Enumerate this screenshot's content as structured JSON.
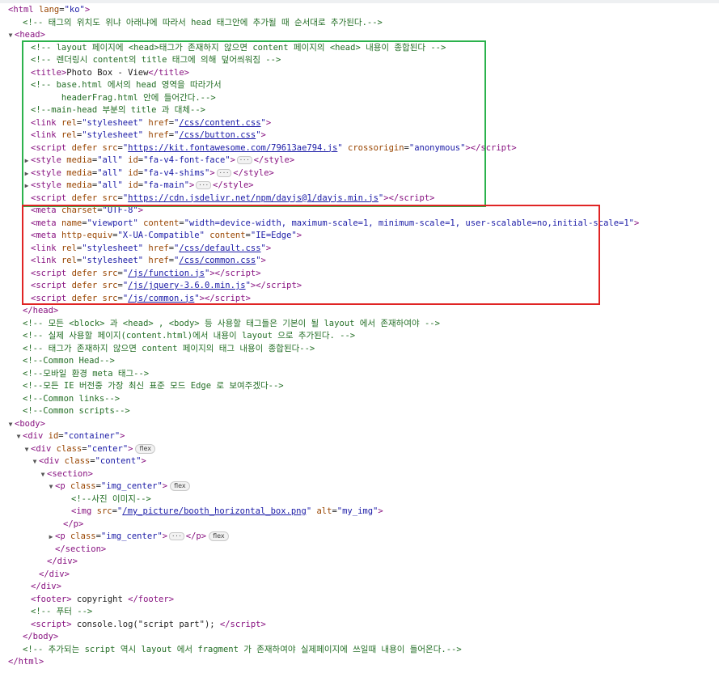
{
  "lines": [
    {
      "indent": 0,
      "toggle": "",
      "html": "<span class='tag'>&lt;html</span> <span class='attr'>lang</span>=<span class='val'>\"ko\"</span><span class='tag'>&gt;</span>"
    },
    {
      "indent": 2,
      "toggle": "",
      "html": "<span class='comment'>&lt;!-- 태그의 위치도 위냐 아래냐에 따라서 head 태그안에 추가될 때 순서대로 추가된다.--&gt;</span>"
    },
    {
      "indent": 1,
      "toggle": "open",
      "html": "<span class='tag'>&lt;head&gt;</span>"
    },
    {
      "indent": 3,
      "toggle": "",
      "html": "<span class='comment'>&lt;!-- layout 페이지에 &lt;head&gt;태그가 존재하지 않으면 content 페이지의 &lt;head&gt; 내용이 종합된다 --&gt;</span>"
    },
    {
      "indent": 3,
      "toggle": "",
      "html": "<span class='comment'>&lt;!-- 렌더링시 content의 title 태그에 의해 덮어씌워짐 --&gt;</span>"
    },
    {
      "indent": 3,
      "toggle": "",
      "html": "<span class='tag'>&lt;title&gt;</span><span class='txt'>Photo Box - View</span><span class='tag'>&lt;/title&gt;</span>"
    },
    {
      "indent": 3,
      "toggle": "",
      "html": "<span class='comment'>&lt;!-- base.html 에서의 head 영역을 따라가서</span>"
    },
    {
      "indent": 3,
      "toggle": "",
      "html": "<span class='comment'>      headerFrag.html 안에 들어간다.--&gt;</span>"
    },
    {
      "indent": 3,
      "toggle": "",
      "html": "<span class='comment'>&lt;!--main-head 부분의 title 과 대체--&gt;</span>"
    },
    {
      "indent": 3,
      "toggle": "",
      "html": "<span class='tag'>&lt;link</span> <span class='attr'>rel</span>=<span class='val'>\"stylesheet\"</span> <span class='attr'>href</span>=<span class='val'>\"</span><span class='link'>/css/content.css</span><span class='val'>\"</span><span class='tag'>&gt;</span>"
    },
    {
      "indent": 3,
      "toggle": "",
      "html": "<span class='tag'>&lt;link</span> <span class='attr'>rel</span>=<span class='val'>\"stylesheet\"</span> <span class='attr'>href</span>=<span class='val'>\"</span><span class='link'>/css/button.css</span><span class='val'>\"</span><span class='tag'>&gt;</span>"
    },
    {
      "indent": 3,
      "toggle": "",
      "html": "<span class='tag'>&lt;script</span> <span class='attr'>defer</span> <span class='attr'>src</span>=<span class='val'>\"</span><span class='link'>https://kit.fontawesome.com/79613ae794.js</span><span class='val'>\"</span> <span class='attr'>crossorigin</span>=<span class='val'>\"anonymous\"</span><span class='tag'>&gt;&lt;/script&gt;</span>"
    },
    {
      "indent": 3,
      "toggle": "closed",
      "html": "<span class='tag'>&lt;style</span> <span class='attr'>media</span>=<span class='val'>\"all\"</span> <span class='attr'>id</span>=<span class='val'>\"fa-v4-font-face\"</span><span class='tag'>&gt;</span><span class='ell'>···</span><span class='tag'>&lt;/style&gt;</span>"
    },
    {
      "indent": 3,
      "toggle": "closed",
      "html": "<span class='tag'>&lt;style</span> <span class='attr'>media</span>=<span class='val'>\"all\"</span> <span class='attr'>id</span>=<span class='val'>\"fa-v4-shims\"</span><span class='tag'>&gt;</span><span class='ell'>···</span><span class='tag'>&lt;/style&gt;</span>"
    },
    {
      "indent": 3,
      "toggle": "closed",
      "html": "<span class='tag'>&lt;style</span> <span class='attr'>media</span>=<span class='val'>\"all\"</span> <span class='attr'>id</span>=<span class='val'>\"fa-main\"</span><span class='tag'>&gt;</span><span class='ell'>···</span><span class='tag'>&lt;/style&gt;</span>"
    },
    {
      "indent": 3,
      "toggle": "",
      "html": "<span class='tag'>&lt;script</span> <span class='attr'>defer</span> <span class='attr'>src</span>=<span class='val'>\"</span><span class='link'>https://cdn.jsdelivr.net/npm/dayjs@1/dayjs.min.js</span><span class='val'>\"</span><span class='tag'>&gt;&lt;/script&gt;</span>"
    },
    {
      "indent": 3,
      "toggle": "",
      "html": "<span class='tag'>&lt;meta</span> <span class='attr'>charset</span>=<span class='val'>\"UTF-8\"</span><span class='tag'>&gt;</span>"
    },
    {
      "indent": 3,
      "toggle": "",
      "html": "<span class='tag'>&lt;meta</span> <span class='attr'>name</span>=<span class='val'>\"viewport\"</span> <span class='attr'>content</span>=<span class='val'>\"width=device-width, maximum-scale=1, minimum-scale=1, user-scalable=no,initial-scale=1\"</span><span class='tag'>&gt;</span>"
    },
    {
      "indent": 3,
      "toggle": "",
      "html": "<span class='tag'>&lt;meta</span> <span class='attr'>http-equiv</span>=<span class='val'>\"X-UA-Compatible\"</span> <span class='attr'>content</span>=<span class='val'>\"IE=Edge\"</span><span class='tag'>&gt;</span>"
    },
    {
      "indent": 3,
      "toggle": "",
      "html": "<span class='tag'>&lt;link</span> <span class='attr'>rel</span>=<span class='val'>\"stylesheet\"</span> <span class='attr'>href</span>=<span class='val'>\"</span><span class='link'>/css/default.css</span><span class='val'>\"</span><span class='tag'>&gt;</span>"
    },
    {
      "indent": 3,
      "toggle": "",
      "html": "<span class='tag'>&lt;link</span> <span class='attr'>rel</span>=<span class='val'>\"stylesheet\"</span> <span class='attr'>href</span>=<span class='val'>\"</span><span class='link'>/css/common.css</span><span class='val'>\"</span><span class='tag'>&gt;</span>"
    },
    {
      "indent": 3,
      "toggle": "",
      "html": "<span class='tag'>&lt;script</span> <span class='attr'>defer</span> <span class='attr'>src</span>=<span class='val'>\"</span><span class='link'>/js/function.js</span><span class='val'>\"</span><span class='tag'>&gt;&lt;/script&gt;</span>"
    },
    {
      "indent": 3,
      "toggle": "",
      "html": "<span class='tag'>&lt;script</span> <span class='attr'>defer</span> <span class='attr'>src</span>=<span class='val'>\"</span><span class='link'>/js/jquery-3.6.0.min.js</span><span class='val'>\"</span><span class='tag'>&gt;&lt;/script&gt;</span>"
    },
    {
      "indent": 3,
      "toggle": "",
      "html": "<span class='tag'>&lt;script</span> <span class='attr'>defer</span> <span class='attr'>src</span>=<span class='val'>\"</span><span class='link'>/js/common.js</span><span class='val'>\"</span><span class='tag'>&gt;&lt;/script&gt;</span>"
    },
    {
      "indent": 2,
      "toggle": "",
      "html": "<span class='tag'>&lt;/head&gt;</span>"
    },
    {
      "indent": 2,
      "toggle": "",
      "html": "<span class='comment'>&lt;!-- 모든 &lt;block&gt; 과 &lt;head&gt; , &lt;body&gt; 등 사용할 태그들은 기본이 될 layout 에서 존재하여야 --&gt;</span>"
    },
    {
      "indent": 2,
      "toggle": "",
      "html": "<span class='comment'>&lt;!-- 실제 사용할 페이지(content.html)에서 내용이 layout 으로 추가된다. --&gt;</span>"
    },
    {
      "indent": 2,
      "toggle": "",
      "html": "<span class='comment'>&lt;!-- 태그가 존재하지 않으면 content 페이지의 태그 내용이 종합된다--&gt;</span>"
    },
    {
      "indent": 2,
      "toggle": "",
      "html": "<span class='comment'>&lt;!--Common Head--&gt;</span>"
    },
    {
      "indent": 2,
      "toggle": "",
      "html": "<span class='comment'>&lt;!--모바일 환경 meta 태그--&gt;</span>"
    },
    {
      "indent": 2,
      "toggle": "",
      "html": "<span class='comment'>&lt;!--모든 IE 버전중 가장 최신 표준 모드 Edge 로 보여주겠다--&gt;</span>"
    },
    {
      "indent": 2,
      "toggle": "",
      "html": "<span class='comment'>&lt;!--Common links--&gt;</span>"
    },
    {
      "indent": 2,
      "toggle": "",
      "html": "<span class='comment'>&lt;!--Common scripts--&gt;</span>"
    },
    {
      "indent": 1,
      "toggle": "open",
      "html": "<span class='tag'>&lt;body&gt;</span>"
    },
    {
      "indent": 2,
      "toggle": "open",
      "html": "<span class='tag'>&lt;div</span> <span class='attr'>id</span>=<span class='val'>\"container\"</span><span class='tag'>&gt;</span>"
    },
    {
      "indent": 3,
      "toggle": "open",
      "html": "<span class='tag'>&lt;div</span> <span class='attr'>class</span>=<span class='val'>\"center\"</span><span class='tag'>&gt;</span><span class='pill'>flex</span>"
    },
    {
      "indent": 4,
      "toggle": "open",
      "html": "<span class='tag'>&lt;div</span> <span class='attr'>class</span>=<span class='val'>\"content\"</span><span class='tag'>&gt;</span>"
    },
    {
      "indent": 5,
      "toggle": "open",
      "html": "<span class='tag'>&lt;section&gt;</span>"
    },
    {
      "indent": 6,
      "toggle": "open",
      "html": "<span class='tag'>&lt;p</span> <span class='attr'>class</span>=<span class='val'>\"img_center\"</span><span class='tag'>&gt;</span><span class='pill'>flex</span>"
    },
    {
      "indent": 8,
      "toggle": "",
      "html": "<span class='comment'>&lt;!--사진 이미지--&gt;</span>"
    },
    {
      "indent": 8,
      "toggle": "",
      "html": "<span class='tag'>&lt;img</span> <span class='attr'>src</span>=<span class='val'>\"</span><span class='link'>/my_picture/booth_horizontal_box.png</span><span class='val'>\"</span> <span class='attr'>alt</span>=<span class='val'>\"my_img\"</span><span class='tag'>&gt;</span>"
    },
    {
      "indent": 7,
      "toggle": "",
      "html": "<span class='tag'>&lt;/p&gt;</span>"
    },
    {
      "indent": 6,
      "toggle": "closed",
      "html": "<span class='tag'>&lt;p</span> <span class='attr'>class</span>=<span class='val'>\"img_center\"</span><span class='tag'>&gt;</span><span class='ell'>···</span><span class='tag'>&lt;/p&gt;</span><span class='pill'>flex</span>"
    },
    {
      "indent": 6,
      "toggle": "",
      "html": "<span class='tag'>&lt;/section&gt;</span>"
    },
    {
      "indent": 5,
      "toggle": "",
      "html": "<span class='tag'>&lt;/div&gt;</span>"
    },
    {
      "indent": 4,
      "toggle": "",
      "html": "<span class='tag'>&lt;/div&gt;</span>"
    },
    {
      "indent": 3,
      "toggle": "",
      "html": "<span class='tag'>&lt;/div&gt;</span>"
    },
    {
      "indent": 3,
      "toggle": "",
      "html": "<span class='tag'>&lt;footer&gt;</span><span class='txt'> copyright </span><span class='tag'>&lt;/footer&gt;</span>"
    },
    {
      "indent": 3,
      "toggle": "",
      "html": "<span class='comment'>&lt;!-- 푸터 --&gt;</span>"
    },
    {
      "indent": 3,
      "toggle": "",
      "html": "<span class='tag'>&lt;script&gt;</span><span class='txt'> console.log(\"script part\"); </span><span class='tag'>&lt;/script&gt;</span>"
    },
    {
      "indent": 2,
      "toggle": "",
      "html": "<span class='tag'>&lt;/body&gt;</span>"
    },
    {
      "indent": 2,
      "toggle": "",
      "html": "<span class='comment'>&lt;!-- 추가되는 script 역시 layout 에서 fragment 가 존재하여야 실제페이지에 쓰일때 내용이 들어온다.--&gt;</span>"
    },
    {
      "indent": 0,
      "toggle": "",
      "html": "<span class='tag'>&lt;/html&gt;</span>"
    }
  ],
  "highlights": {
    "green_color": "#2bb24c",
    "red_color": "#e02424"
  }
}
